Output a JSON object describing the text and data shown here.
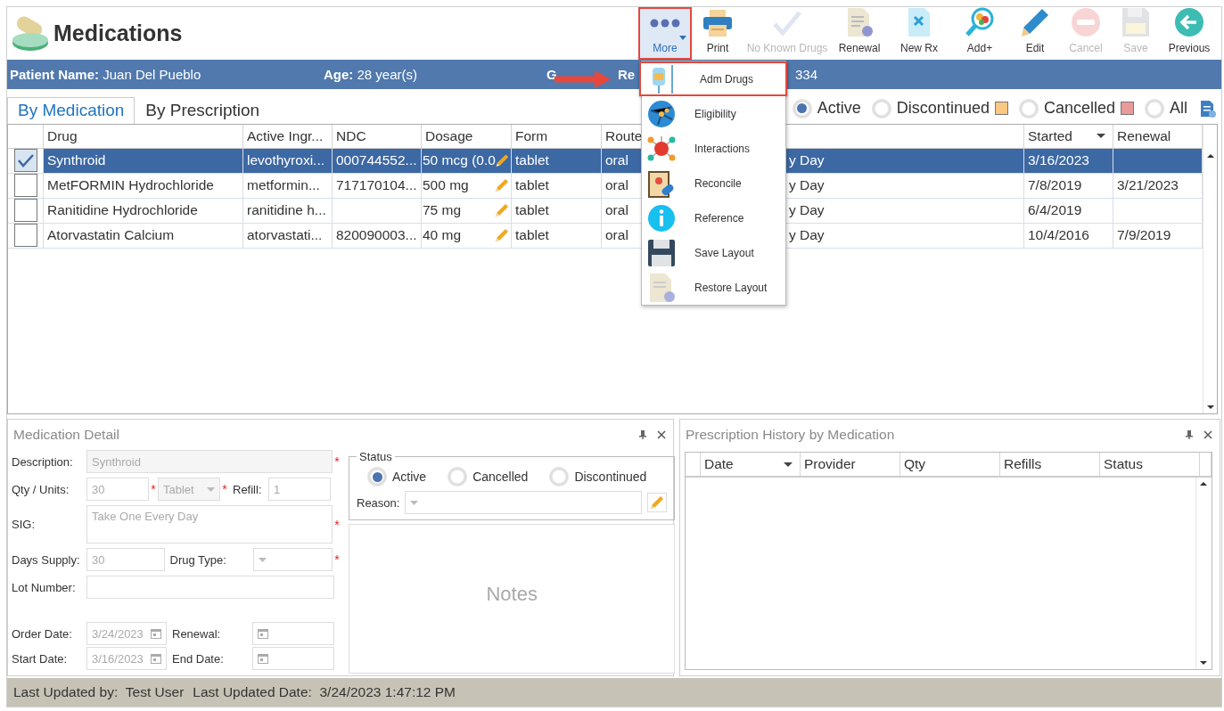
{
  "title": "Medications",
  "toolbar": [
    {
      "label": "More",
      "disabled": false,
      "selected": true
    },
    {
      "label": "Print",
      "disabled": false,
      "selected": false
    },
    {
      "label": "No Known Drugs",
      "disabled": true,
      "selected": false
    },
    {
      "label": "Renewal",
      "disabled": false,
      "selected": false
    },
    {
      "label": "New Rx",
      "disabled": false,
      "selected": false
    },
    {
      "label": "Add+",
      "disabled": false,
      "selected": false
    },
    {
      "label": "Edit",
      "disabled": false,
      "selected": false
    },
    {
      "label": "Cancel",
      "disabled": true,
      "selected": false
    },
    {
      "label": "Save",
      "disabled": true,
      "selected": false
    },
    {
      "label": "Previous",
      "disabled": false,
      "selected": false
    }
  ],
  "patient_bar": [
    {
      "label": "Patient Name:",
      "value": "Juan Del Pueblo"
    },
    {
      "label": "Age:",
      "value": "28 year(s)"
    },
    {
      "label": "G"
    },
    {
      "label": "Re"
    },
    {
      "value": "334"
    }
  ],
  "tabs": [
    {
      "label": "By Medication",
      "selected": true
    },
    {
      "label": "By Prescription",
      "selected": false
    }
  ],
  "filters": [
    {
      "label": "Active",
      "selected": true
    },
    {
      "label": "Discontinued",
      "selected": false,
      "color": "#f9c882"
    },
    {
      "label": "Cancelled",
      "selected": false,
      "color": "#e99a9a"
    },
    {
      "label": "All",
      "selected": false
    }
  ],
  "table": {
    "columns": [
      {
        "label": "Drug",
        "sorted": false
      },
      {
        "label": "Active Ingr...",
        "sorted": false
      },
      {
        "label": "NDC",
        "sorted": false
      },
      {
        "label": "Dosage",
        "sorted": false
      },
      {
        "label": "Form",
        "sorted": false
      },
      {
        "label": "Route",
        "sorted": false
      },
      {
        "sorted": false
      },
      {
        "label": "Started",
        "sorted": true
      },
      {
        "label": "Renewal",
        "sorted": false
      }
    ],
    "rows": [
      {
        "checked": true,
        "selected": true,
        "drug": "Synthroid",
        "ingredient": "levothyroxi...",
        "ndc": "000744552...",
        "dosage": "50 mcg (0.0",
        "form": "tablet",
        "route": "oral",
        "sig": "y Day",
        "started": "3/16/2023"
      },
      {
        "checked": false,
        "selected": false,
        "drug": "MetFORMIN Hydrochloride",
        "ingredient": "metformin...",
        "ndc": "717170104...",
        "dosage": "500 mg",
        "form": "tablet",
        "route": "oral",
        "sig": "y Day",
        "started": "7/8/2019",
        "renewal": "3/21/2023"
      },
      {
        "checked": false,
        "selected": false,
        "drug": "Ranitidine Hydrochloride",
        "ingredient": "ranitidine h...",
        "dosage": "75 mg",
        "form": "tablet",
        "route": "oral",
        "sig": "y Day",
        "started": "6/4/2019"
      },
      {
        "checked": false,
        "selected": false,
        "drug": "Atorvastatin Calcium",
        "ingredient": "atorvastati...",
        "ndc": "820090003...",
        "dosage": "40 mg",
        "form": "tablet",
        "route": "oral",
        "sig": "y Day",
        "started": "10/4/2016",
        "renewal": "7/9/2019"
      }
    ]
  },
  "more_menu": {
    "items": [
      {
        "label": "Adm Drugs",
        "selected": true
      },
      {
        "label": "Eligibility",
        "selected": false
      },
      {
        "label": "Interactions",
        "selected": false
      },
      {
        "label": "Reconcile",
        "selected": false
      },
      {
        "label": "Reference",
        "selected": false
      },
      {
        "label": "Save Layout",
        "selected": false
      },
      {
        "label": "Restore Layout",
        "selected": false
      }
    ]
  },
  "medication_detail": {
    "title": "Medication Detail",
    "required_mark": "*",
    "description": {
      "label": "Description:",
      "value": "Synthroid",
      "required": true
    },
    "qty": {
      "label": "Qty / Units:",
      "value": "30",
      "required": true
    },
    "units": {
      "value": "Tablet",
      "required": true
    },
    "refill": {
      "label": "Refill:",
      "value": "1"
    },
    "sig": {
      "label": "SIG:",
      "value": "Take One Every Day",
      "required": true
    },
    "days_supply": {
      "label": "Days Supply:",
      "value": "30"
    },
    "drug_type": {
      "label": "Drug Type:",
      "required": true
    },
    "lot_number": {
      "label": "Lot Number:"
    },
    "order_date": {
      "label": "Order Date:",
      "value": "3/24/2023"
    },
    "renewal": {
      "label": "Renewal:"
    },
    "start_date": {
      "label": "Start Date:",
      "value": "3/16/2023"
    },
    "end_date": {
      "label": "End Date:"
    },
    "status": {
      "title": "Status",
      "options": [
        {
          "label": "Active",
          "selected": true
        },
        {
          "label": "Cancelled",
          "selected": false
        },
        {
          "label": "Discontinued",
          "selected": false
        }
      ],
      "reason_label": "Reason:"
    },
    "notes": {
      "placeholder": "Notes"
    }
  },
  "prescription_history": {
    "title": "Prescription History by Medication",
    "columns": [
      {
        "label": "Date",
        "sorted": true
      },
      {
        "label": "Provider",
        "sorted": false
      },
      {
        "label": "Qty",
        "sorted": false
      },
      {
        "label": "Refills",
        "sorted": false
      },
      {
        "label": "Status",
        "sorted": false
      }
    ]
  },
  "status_bar": [
    {
      "label": "Last Updated by:",
      "value": "Test User"
    },
    {
      "label": "Last Updated Date:",
      "value": "3/24/2023 1:47:12 PM"
    }
  ]
}
